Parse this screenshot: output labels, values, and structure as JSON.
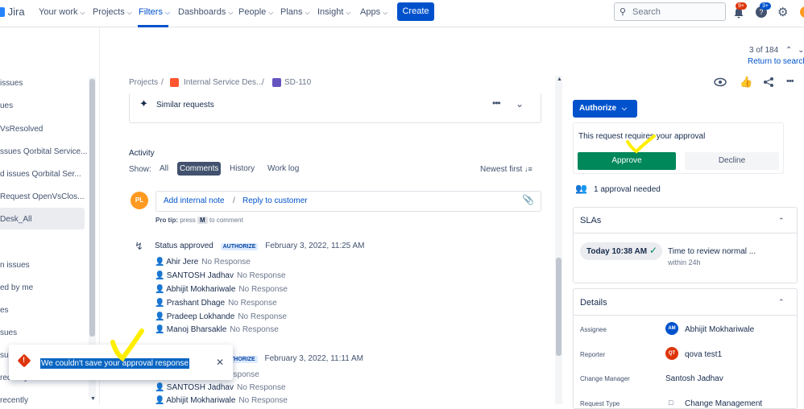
{
  "colors": {
    "accent": "#0052cc",
    "approve": "#00875a",
    "highlight_mark": "#ffee00",
    "error": "#de350b"
  },
  "nav": {
    "logo": "Jira",
    "items": [
      {
        "label": "Your work",
        "chevron": true
      },
      {
        "label": "Projects",
        "chevron": true
      },
      {
        "label": "Filters",
        "chevron": true
      },
      {
        "label": "Dashboards",
        "chevron": true
      },
      {
        "label": "People",
        "chevron": true
      },
      {
        "label": "Plans",
        "chevron": true
      },
      {
        "label": "Insight",
        "chevron": true
      },
      {
        "label": "Apps",
        "chevron": true
      }
    ],
    "create_label": "Create",
    "search_placeholder": "Search",
    "notifications_badge": "9+",
    "help_badge": "3+"
  },
  "sidebar": {
    "items": [
      "issues",
      "ues",
      "VsResolved",
      "ssues Qorbital Service...",
      "d issues Qorbital Ser...",
      "Request OpenVsClos...",
      "Desk_All",
      "n issues",
      "ed by me",
      "es",
      "sues",
      "sue",
      "recently",
      "recently"
    ],
    "active_index": 6
  },
  "pager": {
    "position": "3 of 184",
    "return_label": "Return to search"
  },
  "breadcrumb": {
    "projects": "Projects",
    "service_desk": "Internal Service Des...",
    "issue_key": "SD-110"
  },
  "similar_requests": {
    "label": "Similar requests"
  },
  "activity": {
    "title": "Activity",
    "show_label": "Show:",
    "tabs": [
      "All",
      "Comments",
      "History",
      "Work log"
    ],
    "active_tab": "Comments",
    "sort_label": "Newest first",
    "comment_avatar": "PL",
    "add_internal_note": "Add internal note",
    "separator": "/",
    "reply_to_customer": "Reply to customer",
    "pro_tip_label": "Pro tip:",
    "pro_tip_press": "press",
    "pro_tip_key": "M",
    "pro_tip_rest": "to comment"
  },
  "history": [
    {
      "title": "Status approved",
      "lozenge": "AUTHORIZE",
      "date": "February 3, 2022, 11:25 AM",
      "approvers": [
        {
          "name": "Ahir Jere",
          "status": "No Response"
        },
        {
          "name": "SANTOSH Jadhav",
          "status": "No Response"
        },
        {
          "name": "Abhijit Mokhariwale",
          "status": "No Response"
        },
        {
          "name": "Prashant Dhage",
          "status": "No Response"
        },
        {
          "name": "Pradeep Lokhande",
          "status": "No Response"
        },
        {
          "name": "Manoj Bharsakle",
          "status": "No Response"
        }
      ]
    },
    {
      "lozenge_partial": "THORIZE",
      "date": "February 3, 2022, 11:11 AM",
      "approvers": [
        {
          "name": "",
          "status": "esponse"
        },
        {
          "name": "SANTOSH Jadhav",
          "status": "No Response"
        },
        {
          "name": "Abhijit Mokhariwale",
          "status": "No Response"
        }
      ]
    }
  ],
  "right": {
    "authorize_label": "Authorize",
    "approval_text": "This request requires your approval",
    "approve_label": "Approve",
    "decline_label": "Decline",
    "approvals_needed": "1 approval needed",
    "slas_title": "SLAs",
    "sla_time": "Today 10:38 AM",
    "sla_goal": "Time to review normal ...",
    "sla_within": "within 24h",
    "details_title": "Details",
    "details": [
      {
        "label": "Assignee",
        "avatar": "AM",
        "value": "Abhijit Mokhariwale"
      },
      {
        "label": "Reporter",
        "avatar": "QT",
        "value": "qova test1"
      },
      {
        "label": "Change Manager",
        "value": "Santosh Jadhav"
      },
      {
        "label": "Request Type",
        "value": "Change Management"
      }
    ]
  },
  "toast": {
    "message": "We couldn't save your approval response"
  }
}
